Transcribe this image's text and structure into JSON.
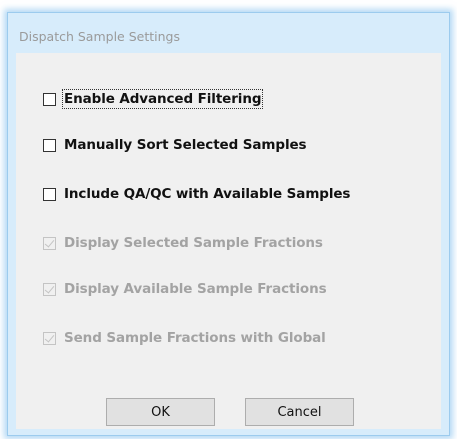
{
  "dialog": {
    "title": "Dispatch Sample Settings"
  },
  "options": [
    {
      "label": "Enable Advanced Filtering",
      "checked": false,
      "enabled": true
    },
    {
      "label": "Manually Sort Selected Samples",
      "checked": false,
      "enabled": true
    },
    {
      "label": "Include QA/QC with Available Samples",
      "checked": false,
      "enabled": true
    },
    {
      "label": "Display Selected Sample Fractions",
      "checked": true,
      "enabled": false
    },
    {
      "label": "Display Available Sample Fractions",
      "checked": true,
      "enabled": false
    },
    {
      "label": "Send Sample Fractions with Global",
      "checked": true,
      "enabled": false
    }
  ],
  "buttons": {
    "ok_label": "OK",
    "cancel_label": "Cancel"
  },
  "colors": {
    "frame": "#d7ecfb",
    "client": "#f0f0f0",
    "disabled_text": "#a3a3a3",
    "button_face": "#e1e1e1"
  }
}
